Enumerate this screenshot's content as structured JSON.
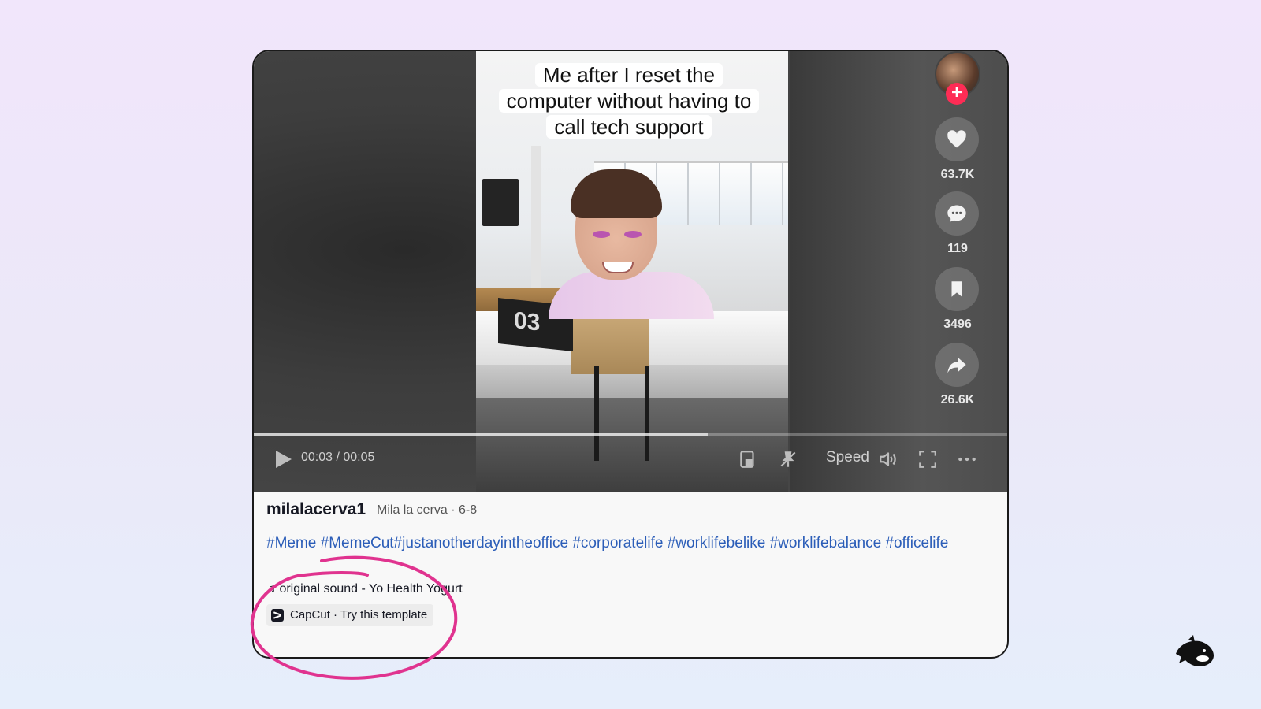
{
  "video": {
    "caption": "Me after I reset the computer without having to call tech support",
    "box_number": "03",
    "time": "00:03 / 00:05",
    "progress": 0.6,
    "speed_label": "Speed"
  },
  "actions": {
    "likes": "63.7K",
    "comments": "119",
    "saves": "3496",
    "shares": "26.6K"
  },
  "post": {
    "username": "milalacerva1",
    "nickname_date": "Mila la cerva · 6-8",
    "hashtags": "#Meme #MemeCut#justanotherdayintheoffice #corporatelife #worklifebelike #worklifebalance #officelife",
    "sound": "original sound - Yo Health Yogurt",
    "capcut": "CapCut · Try this template"
  },
  "colors": {
    "accent": "#fe2c55",
    "hashtag": "#2b5db8",
    "annotation": "#e0338f"
  },
  "icons": [
    "play-icon",
    "picture-in-picture-icon",
    "pin-icon",
    "volume-icon",
    "fullscreen-icon",
    "more-icon",
    "heart-icon",
    "comment-icon",
    "bookmark-icon",
    "share-icon",
    "music-note-icon",
    "capcut-icon",
    "orca-logo-icon"
  ]
}
